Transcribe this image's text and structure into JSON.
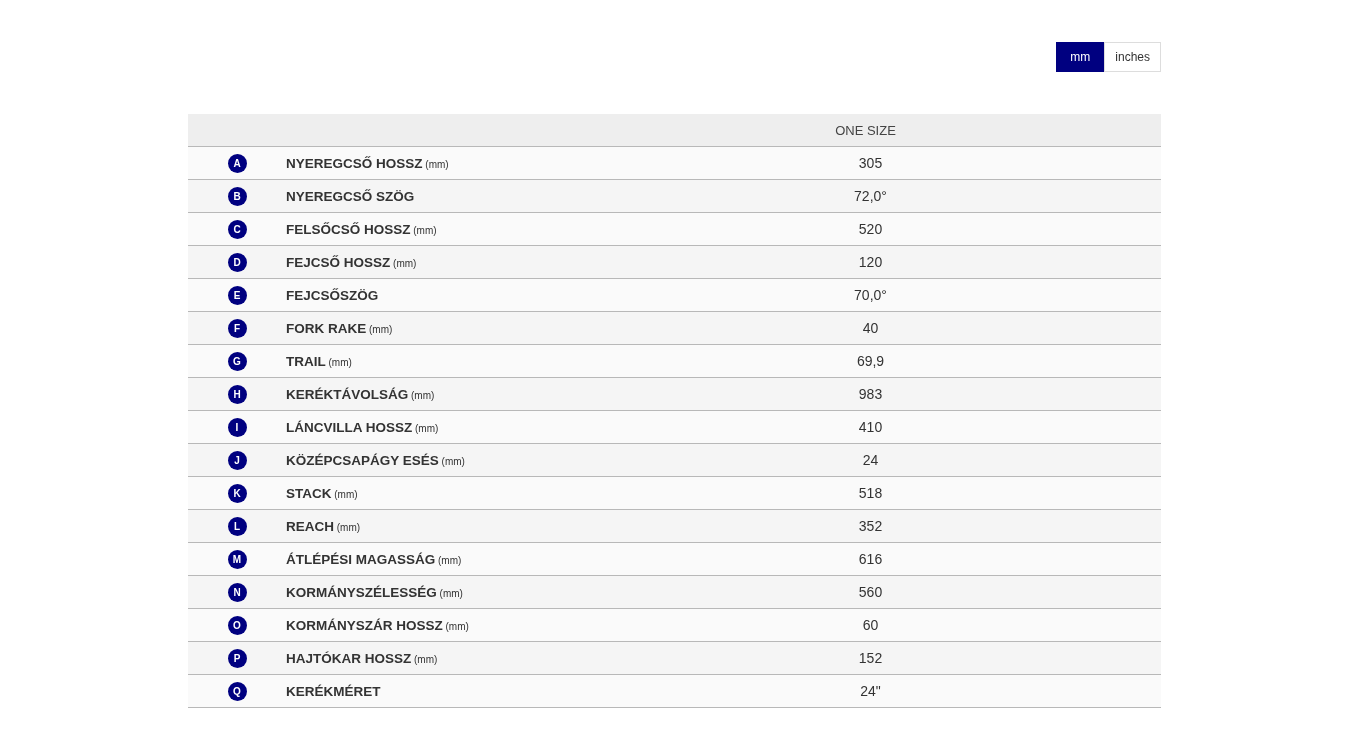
{
  "units": [
    {
      "label": "mm",
      "selected": true
    },
    {
      "label": "inches",
      "selected": false
    }
  ],
  "table": {
    "columns": [
      "ONE SIZE"
    ],
    "rows": [
      {
        "letter": "A",
        "label": "**NYEREGCSŐ HOSSZ** (mm)",
        "value": "305"
      },
      {
        "letter": "B",
        "label": "**NYEREGCSŐ SZÖG**",
        "value": "72,0°"
      },
      {
        "letter": "C",
        "label": "**FELSŐCSŐ HOSSZ** (mm)",
        "value": "520"
      },
      {
        "letter": "D",
        "label": "**FEJCSŐ HOSSZ** (mm)",
        "value": "120"
      },
      {
        "letter": "E",
        "label": "**FEJCSŐSZÖG**",
        "value": "70,0°"
      },
      {
        "letter": "F",
        "label": "**FORK RAKE** (mm)",
        "value": "40"
      },
      {
        "letter": "G",
        "label": "**TRAIL** (mm)",
        "value": "69,9"
      },
      {
        "letter": "H",
        "label": "**KERÉKTÁVOLSÁG** (mm)",
        "value": "983"
      },
      {
        "letter": "I",
        "label": "**LÁNCVILLA HOSSZ** (mm)",
        "value": "410"
      },
      {
        "letter": "J",
        "label": "**KÖZÉPCSAPÁGY ESÉS** (mm)",
        "value": "24"
      },
      {
        "letter": "K",
        "label": "**STACK** (mm)",
        "value": "518"
      },
      {
        "letter": "L",
        "label": "**REACH** (mm)",
        "value": "352"
      },
      {
        "letter": "M",
        "label": "**ÁTLÉPÉSI MAGASSÁG** (mm)",
        "value": "616"
      },
      {
        "letter": "N",
        "label": "**KORMÁNYSZÉLESSÉG** (mm)",
        "value": "560"
      },
      {
        "letter": "O",
        "label": "**KORMÁNYSZÁR HOSSZ** (mm)",
        "value": "60"
      },
      {
        "letter": "P",
        "label": "**HAJTÓKAR HOSSZ** (mm)",
        "value": "152"
      },
      {
        "letter": "Q",
        "label": "**KERÉKMÉRET**",
        "value": "24\""
      }
    ]
  }
}
